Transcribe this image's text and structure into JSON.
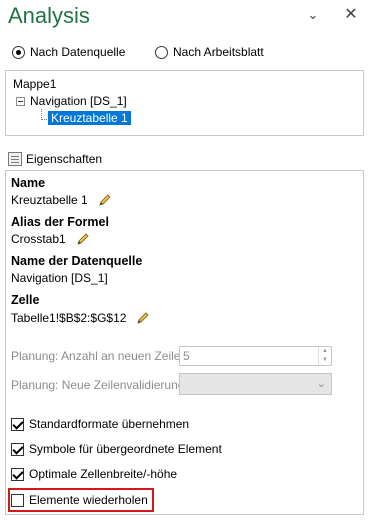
{
  "title": "Analysis",
  "window_controls": {
    "dropdown": "⌄",
    "close": "✕"
  },
  "source_options": [
    {
      "label": "Nach Datenquelle",
      "selected": true
    },
    {
      "label": "Nach Arbeitsblatt",
      "selected": false
    }
  ],
  "tree": {
    "root": "Mappe1",
    "child": "Navigation [DS_1]",
    "selected": "Kreuztabelle 1"
  },
  "properties": {
    "header": "Eigenschaften",
    "name_label": "Name",
    "name_value": "Kreuztabelle 1",
    "alias_label": "Alias der Formel",
    "alias_value": "Crosstab1",
    "datasource_label": "Name der Datenquelle",
    "datasource_value": "Navigation [DS_1]",
    "cell_label": "Zelle",
    "cell_value": "Tabelle1!$B$2:$G$12"
  },
  "planning": {
    "new_rows_label": "Planung: Anzahl an neuen Zeilen",
    "new_rows_value": "5",
    "validation_label": "Planung: Neue Zeilenvalidierung",
    "validation_value": ""
  },
  "checkboxes": [
    {
      "label": "Standardformate übernehmen",
      "checked": true
    },
    {
      "label": "Symbole für übergeordnete Element",
      "checked": true
    },
    {
      "label": "Optimale Zellenbreite/-höhe",
      "checked": true
    },
    {
      "label": "Elemente wiederholen",
      "checked": false
    }
  ],
  "colors": {
    "title": "#217346",
    "selection": "#0078d7",
    "highlight": "#d01919"
  }
}
